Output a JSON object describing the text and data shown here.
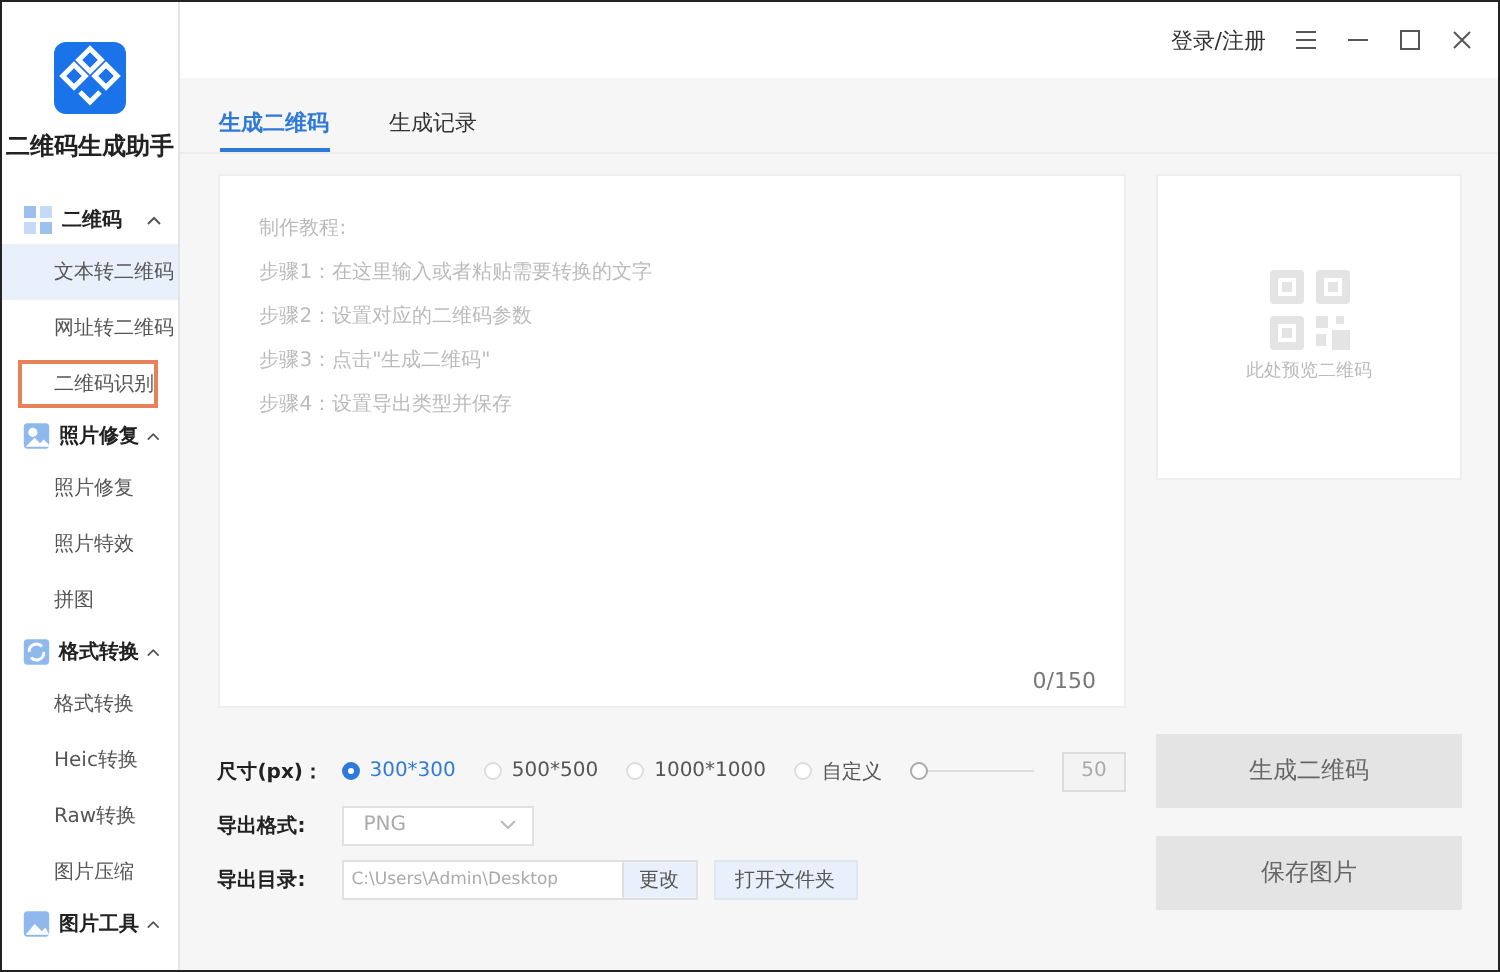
{
  "app": {
    "title": "二维码生成助手"
  },
  "header": {
    "login": "登录/注册"
  },
  "sidebar": {
    "groups": [
      {
        "label": "二维码",
        "expanded": true,
        "items": [
          {
            "label": "文本转二维码",
            "selected": true,
            "outlined": false
          },
          {
            "label": "网址转二维码",
            "selected": false,
            "outlined": false
          },
          {
            "label": "二维码识别",
            "selected": false,
            "outlined": true
          }
        ]
      },
      {
        "label": "照片修复",
        "expanded": true,
        "items": [
          {
            "label": "照片修复",
            "selected": false,
            "outlined": false
          },
          {
            "label": "照片特效",
            "selected": false,
            "outlined": false
          },
          {
            "label": "拼图",
            "selected": false,
            "outlined": false
          }
        ]
      },
      {
        "label": "格式转换",
        "expanded": true,
        "items": [
          {
            "label": "格式转换",
            "selected": false,
            "outlined": false
          },
          {
            "label": "Heic转换",
            "selected": false,
            "outlined": false
          },
          {
            "label": "Raw转换",
            "selected": false,
            "outlined": false
          },
          {
            "label": "图片压缩",
            "selected": false,
            "outlined": false
          }
        ]
      },
      {
        "label": "图片工具",
        "expanded": true
      }
    ]
  },
  "tabs": [
    {
      "label": "生成二维码",
      "selected": true
    },
    {
      "label": "生成记录",
      "selected": false
    }
  ],
  "editor": {
    "hint_lines": [
      "制作教程:",
      "步骤1：在这里输入或者粘贴需要转换的文字",
      "步骤2：设置对应的二维码参数",
      "步骤3：点击\"生成二维码\"",
      "步骤4：设置导出类型并保存"
    ],
    "counter": "0/150"
  },
  "preview": {
    "caption": "此处预览二维码"
  },
  "size": {
    "label": "尺寸(px)：",
    "options": [
      {
        "label": "300*300",
        "selected": true
      },
      {
        "label": "500*500",
        "selected": false
      },
      {
        "label": "1000*1000",
        "selected": false
      },
      {
        "label": "自定义",
        "selected": false
      }
    ],
    "custom": {
      "level": 0,
      "value": "50"
    }
  },
  "format": {
    "label": "导出格式:",
    "value": "PNG"
  },
  "directory": {
    "label": "导出目录:",
    "path": "C:\\Users\\Admin\\Desktop",
    "change": "更改",
    "open": "打开文件夹"
  },
  "buttons": [
    {
      "label": "生成二维码"
    },
    {
      "label": "保存图片"
    }
  ]
}
